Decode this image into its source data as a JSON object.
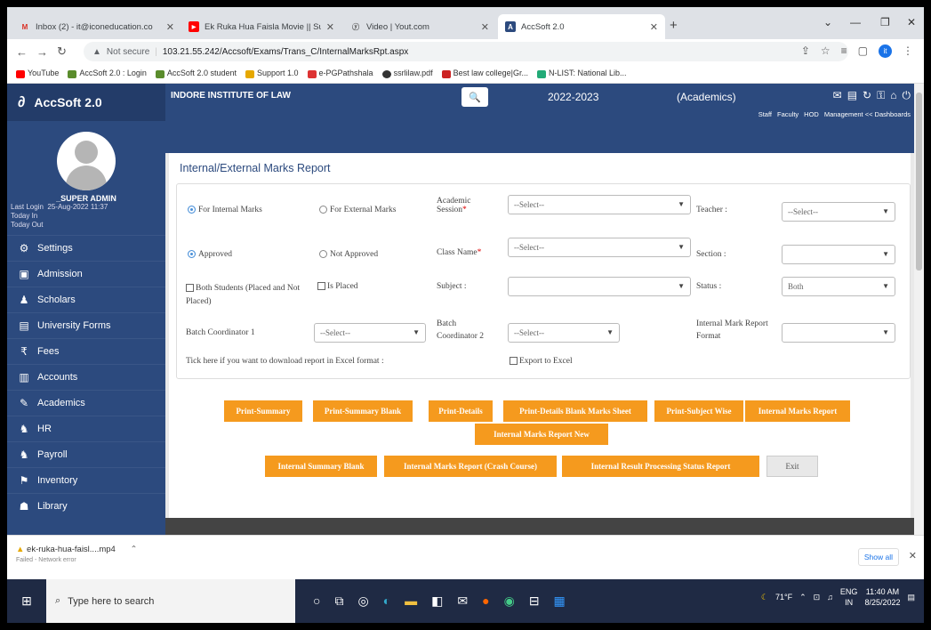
{
  "browser": {
    "tabs": [
      {
        "label": "Inbox (2) - it@iconeducation.co",
        "fav": "M",
        "color": "#d93025"
      },
      {
        "label": "Ek Ruka Hua Faisla Movie || Subt",
        "fav": "▶",
        "color": "#ff0000"
      },
      {
        "label": "Video | Yout.com",
        "fav": "ⓨ",
        "color": "#555555"
      },
      {
        "label": "AccSoft 2.0",
        "fav": "A",
        "color": "#2c4a7e"
      }
    ],
    "address": {
      "secure_label": "Not secure",
      "url": "103.21.55.242/Accsoft/Exams/Trans_C/InternalMarksRpt.aspx"
    },
    "bookmarks": [
      "YouTube",
      "AccSoft 2.0 : Login",
      "AccSoft 2.0 student",
      "Support 1.0",
      "e-PGPathshala",
      "ssrlilaw.pdf",
      "Best law college|Gr...",
      "N-LIST: National Lib..."
    ]
  },
  "sidebar": {
    "brand": "AccSoft 2.0",
    "user": "_SUPER ADMIN",
    "last_login_label": "Last Login",
    "last_login_value": "25-Aug-2022 11:37",
    "today_in": "Today In",
    "today_out": "Today Out",
    "items": [
      {
        "label": "Settings",
        "icon": "⚙"
      },
      {
        "label": "Admission",
        "icon": "▣"
      },
      {
        "label": "Scholars",
        "icon": "♟"
      },
      {
        "label": "University Forms",
        "icon": "▤"
      },
      {
        "label": "Fees",
        "icon": "₹"
      },
      {
        "label": "Accounts",
        "icon": "▥"
      },
      {
        "label": "Academics",
        "icon": "✎"
      },
      {
        "label": "HR",
        "icon": "♞"
      },
      {
        "label": "Payroll",
        "icon": "♞"
      },
      {
        "label": "Inventory",
        "icon": "⚑"
      },
      {
        "label": "Library",
        "icon": "☗"
      }
    ]
  },
  "topbar": {
    "institute": "INDORE INSTITUTE OF LAW",
    "year": "2022-2023",
    "context": "(Academics)",
    "links": [
      "Staff",
      "Faculty",
      "HOD",
      "Management << Dashboards"
    ]
  },
  "form": {
    "title": "Internal/External Marks Report",
    "for_internal": "For Internal Marks",
    "for_external": "For External Marks",
    "approved": "Approved",
    "not_approved": "Not Approved",
    "both_students": "Both Students (Placed and Not Placed)",
    "is_placed": "Is Placed",
    "academic_session": "Academic Session",
    "class_name": "Class Name",
    "subject": "Subject :",
    "teacher": "Teacher :",
    "section": "Section :",
    "status": "Status :",
    "status_value": "Both",
    "batch_coord1": "Batch Coordinator 1",
    "batch_coord2": "Batch Coordinator 2",
    "imr_format": "Internal Mark Report Format",
    "select_placeholder": "--Select--",
    "excel_tip": "Tick here if you want to download report in Excel format :",
    "export_excel": "Export to Excel"
  },
  "buttons": {
    "print_summary": "Print-Summary",
    "print_summary_blank": "Print-Summary Blank",
    "print_details": "Print-Details",
    "print_details_blank": "Print-Details Blank Marks Sheet",
    "print_subject_wise": "Print-Subject Wise",
    "internal_marks_report": "Internal Marks Report",
    "internal_marks_report_new": "Internal Marks Report New",
    "internal_summary_blank": "Internal Summary Blank",
    "internal_marks_crash": "Internal Marks Report (Crash Course)",
    "internal_result_status": "Internal Result Processing Status Report",
    "exit": "Exit"
  },
  "download": {
    "file": "ek-ruka-hua-faisl....mp4",
    "status": "Failed - Network error",
    "show_all": "Show all"
  },
  "taskbar": {
    "search": "Type here to search",
    "temp": "71°F",
    "lang": "ENG",
    "region": "IN",
    "time": "11:40 AM",
    "date": "8/25/2022"
  }
}
